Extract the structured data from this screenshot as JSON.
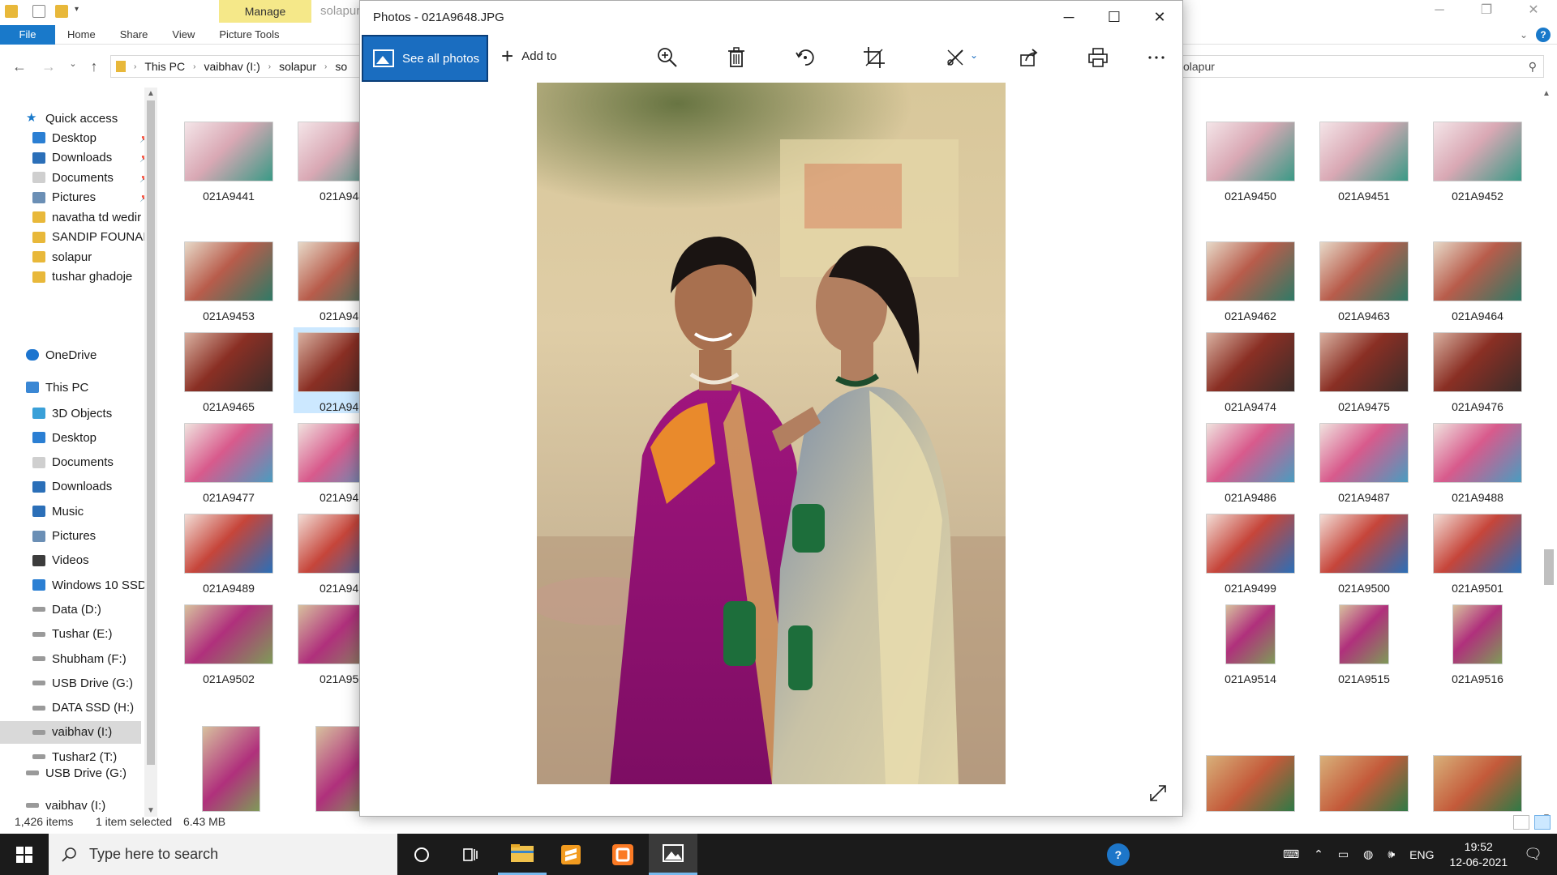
{
  "explorer": {
    "window_title": "solapur",
    "context_tab": "Manage",
    "tabs": [
      "File",
      "Home",
      "Share",
      "View",
      "Picture Tools"
    ],
    "breadcrumb": [
      "This PC",
      "vaibhav  (I:)",
      "solapur",
      "so"
    ],
    "search_text": "olapur",
    "nav": {
      "quick_access": "Quick access",
      "quick_items": [
        "Desktop",
        "Downloads",
        "Documents",
        "Pictures",
        "navatha td wedir",
        "SANDIP FOUNAI",
        "solapur",
        "tushar ghadoje"
      ],
      "onedrive": "OneDrive",
      "this_pc": "This PC",
      "pc_items": [
        "3D Objects",
        "Desktop",
        "Documents",
        "Downloads",
        "Music",
        "Pictures",
        "Videos",
        "Windows 10 SSD",
        "Data (D:)",
        "Tushar (E:)",
        "Shubham (F:)",
        "USB Drive (G:)",
        "DATA SSD (H:)",
        "vaibhav  (I:)",
        "Tushar2 (T:)"
      ],
      "usb_drive": "USB Drive (G:)",
      "vaibhav_bottom": "vaibhav  (I:)"
    },
    "files_left": [
      [
        "021A9441",
        "021A944"
      ],
      [
        "021A9453",
        "021A945"
      ],
      [
        "021A9465",
        "021A946"
      ],
      [
        "021A9477",
        "021A947"
      ],
      [
        "021A9489",
        "021A949"
      ],
      [
        "021A9502",
        "021A950"
      ]
    ],
    "files_right": [
      [
        "021A9450",
        "021A9451",
        "021A9452"
      ],
      [
        "021A9462",
        "021A9463",
        "021A9464"
      ],
      [
        "021A9474",
        "021A9475",
        "021A9476"
      ],
      [
        "021A9486",
        "021A9487",
        "021A9488"
      ],
      [
        "021A9499",
        "021A9500",
        "021A9501"
      ],
      [
        "021A9514",
        "021A9515",
        "021A9516"
      ]
    ],
    "status": {
      "items": "1,426 items",
      "selected": "1 item selected",
      "size": "6.43 MB"
    }
  },
  "photos": {
    "title": "Photos - 021A9648.JPG",
    "see_all": "See all photos",
    "add_to": "Add to",
    "toolbar_icons": [
      "zoom-icon",
      "delete-icon",
      "rotate-icon",
      "crop-icon",
      "edit-icon",
      "share-icon",
      "print-icon",
      "more-icon"
    ]
  },
  "taskbar": {
    "search_placeholder": "Type here to search",
    "lang": "ENG",
    "time": "19:52",
    "date": "12-06-2021"
  },
  "colors": {
    "accent": "#1979ca",
    "manage_tab": "#f5e889",
    "see_all_bg": "#1a6dc0",
    "taskbar": "#1b1b1b"
  }
}
